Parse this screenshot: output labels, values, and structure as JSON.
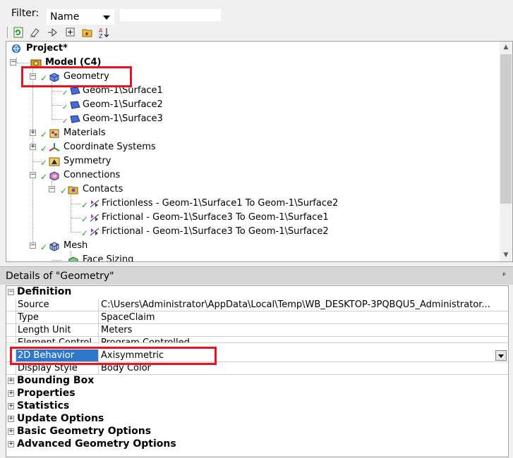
{
  "filter": {
    "label": "Filter:",
    "selected": "Name",
    "search_value": ""
  },
  "toolbar": {
    "buttons": [
      "refresh-icon",
      "erase-icon",
      "expand-icon",
      "add-icon",
      "folder-icon",
      "sort-az-icon"
    ],
    "sort_label": "AZ"
  },
  "tree": {
    "project": "Project*",
    "model": "Model (C4)",
    "geometry": "Geometry",
    "surfaces": [
      "Geom-1\\Surface1",
      "Geom-1\\Surface2",
      "Geom-1\\Surface3"
    ],
    "materials": "Materials",
    "coordinate_systems": "Coordinate Systems",
    "symmetry": "Symmetry",
    "connections": "Connections",
    "contacts": "Contacts",
    "contact_items": [
      "Frictionless - Geom-1\\Surface1 To Geom-1\\Surface2",
      "Frictional - Geom-1\\Surface3 To Geom-1\\Surface1",
      "Frictional - Geom-1\\Surface3 To Geom-1\\Surface2"
    ],
    "mesh": "Mesh",
    "face_sizing": "Face Sizing"
  },
  "details": {
    "title": "Details of \"Geometry\"",
    "pin": "ᵖ",
    "definition_label": "Definition",
    "properties": [
      {
        "key": "Source",
        "value": "C:\\Users\\Administrator\\AppData\\Local\\Temp\\WB_DESKTOP-3PQBQU5_Administrator..."
      },
      {
        "key": "Type",
        "value": "SpaceClaim"
      },
      {
        "key": "Length Unit",
        "value": "Meters"
      },
      {
        "key": "Element Control",
        "value": "Program Controlled"
      },
      {
        "key": "2D Behavior",
        "value": "Axisymmetric"
      },
      {
        "key": "Display Style",
        "value": "Body Color"
      }
    ],
    "categories": [
      "Bounding Box",
      "Properties",
      "Statistics",
      "Update Options",
      "Basic Geometry Options",
      "Advanced Geometry Options"
    ]
  },
  "colors": {
    "highlight": "#e8131f",
    "selection": "#2f78c8",
    "check": "#2aa12a"
  }
}
